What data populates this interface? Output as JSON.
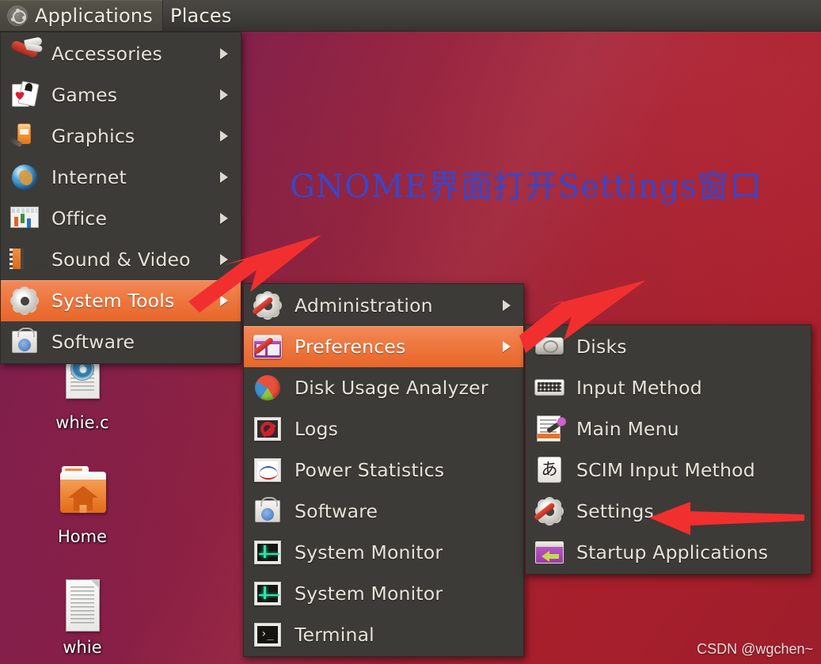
{
  "panel": {
    "applications_label": "Applications",
    "places_label": "Places",
    "logo_icon": "ubuntu-logo-icon"
  },
  "annotation": {
    "title": "GNOME界面打开Settings窗口",
    "title_color": "#3a46c8",
    "arrow_color": "#f22f2f",
    "arrows": [
      {
        "name": "arrow-to-system-tools",
        "points_at": "System Tools"
      },
      {
        "name": "arrow-to-preferences",
        "points_at": "Preferences"
      },
      {
        "name": "arrow-to-settings",
        "points_at": "Settings"
      }
    ]
  },
  "desktop": {
    "icons": [
      {
        "label": "whie.c",
        "icon": "disc-document-icon",
        "type": "disc"
      },
      {
        "label": "Home",
        "icon": "home-folder-icon",
        "type": "folder"
      },
      {
        "label": "whie",
        "icon": "text-document-icon",
        "type": "doc"
      }
    ]
  },
  "menu_applications": {
    "name": "applications-menu",
    "items": [
      {
        "label": "Accessories",
        "icon": "swiss-knife-icon",
        "submenu": true,
        "selected": false
      },
      {
        "label": "Games",
        "icon": "playing-cards-icon",
        "submenu": true,
        "selected": false
      },
      {
        "label": "Graphics",
        "icon": "paint-can-icon",
        "submenu": true,
        "selected": false
      },
      {
        "label": "Internet",
        "icon": "globe-icon",
        "submenu": true,
        "selected": false
      },
      {
        "label": "Office",
        "icon": "spreadsheet-icon",
        "submenu": true,
        "selected": false
      },
      {
        "label": "Sound & Video",
        "icon": "film-music-icon",
        "submenu": true,
        "selected": false
      },
      {
        "label": "System Tools",
        "icon": "gear-icon",
        "submenu": true,
        "selected": true
      },
      {
        "label": "Software",
        "icon": "software-store-icon",
        "submenu": false,
        "selected": false
      }
    ]
  },
  "menu_system_tools": {
    "name": "system-tools-submenu",
    "items": [
      {
        "label": "Administration",
        "icon": "gear-wrench-icon",
        "submenu": true,
        "selected": false
      },
      {
        "label": "Preferences",
        "icon": "preferences-window-icon",
        "submenu": true,
        "selected": true
      },
      {
        "label": "Disk Usage Analyzer",
        "icon": "pie-chart-icon",
        "submenu": false,
        "selected": false
      },
      {
        "label": "Logs",
        "icon": "no-entry-icon",
        "submenu": false,
        "selected": false
      },
      {
        "label": "Power Statistics",
        "icon": "line-chart-icon",
        "submenu": false,
        "selected": false
      },
      {
        "label": "Software",
        "icon": "software-store-icon",
        "submenu": false,
        "selected": false
      },
      {
        "label": "System Monitor",
        "icon": "monitor-pulse-icon",
        "submenu": false,
        "selected": false
      },
      {
        "label": "System Monitor",
        "icon": "monitor-pulse-icon",
        "submenu": false,
        "selected": false
      },
      {
        "label": "Terminal",
        "icon": "terminal-icon",
        "submenu": false,
        "selected": false
      }
    ]
  },
  "menu_preferences": {
    "name": "preferences-submenu",
    "items": [
      {
        "label": "Disks",
        "icon": "disks-icon",
        "submenu": false,
        "selected": false
      },
      {
        "label": "Input Method",
        "icon": "keyboard-icon",
        "submenu": false,
        "selected": false
      },
      {
        "label": "Main Menu",
        "icon": "main-menu-edit-icon",
        "submenu": false,
        "selected": false
      },
      {
        "label": "SCIM Input Method",
        "icon": "scim-hiragana-icon",
        "submenu": false,
        "selected": false
      },
      {
        "label": "Settings",
        "icon": "gear-wrench-icon",
        "submenu": false,
        "selected": false
      },
      {
        "label": "Startup Applications",
        "icon": "startup-applications-icon",
        "submenu": false,
        "selected": false
      }
    ]
  },
  "watermark": {
    "text": "CSDN @wgchen~"
  },
  "colors": {
    "menu_bg": "#3d3b37",
    "menu_text": "#e8e3da",
    "highlight_from": "#f3895a",
    "highlight_to": "#e8662a",
    "panel_bg": "#413f3b",
    "wallpaper_from": "#6f1b4c",
    "wallpaper_to": "#9e1e2b"
  }
}
